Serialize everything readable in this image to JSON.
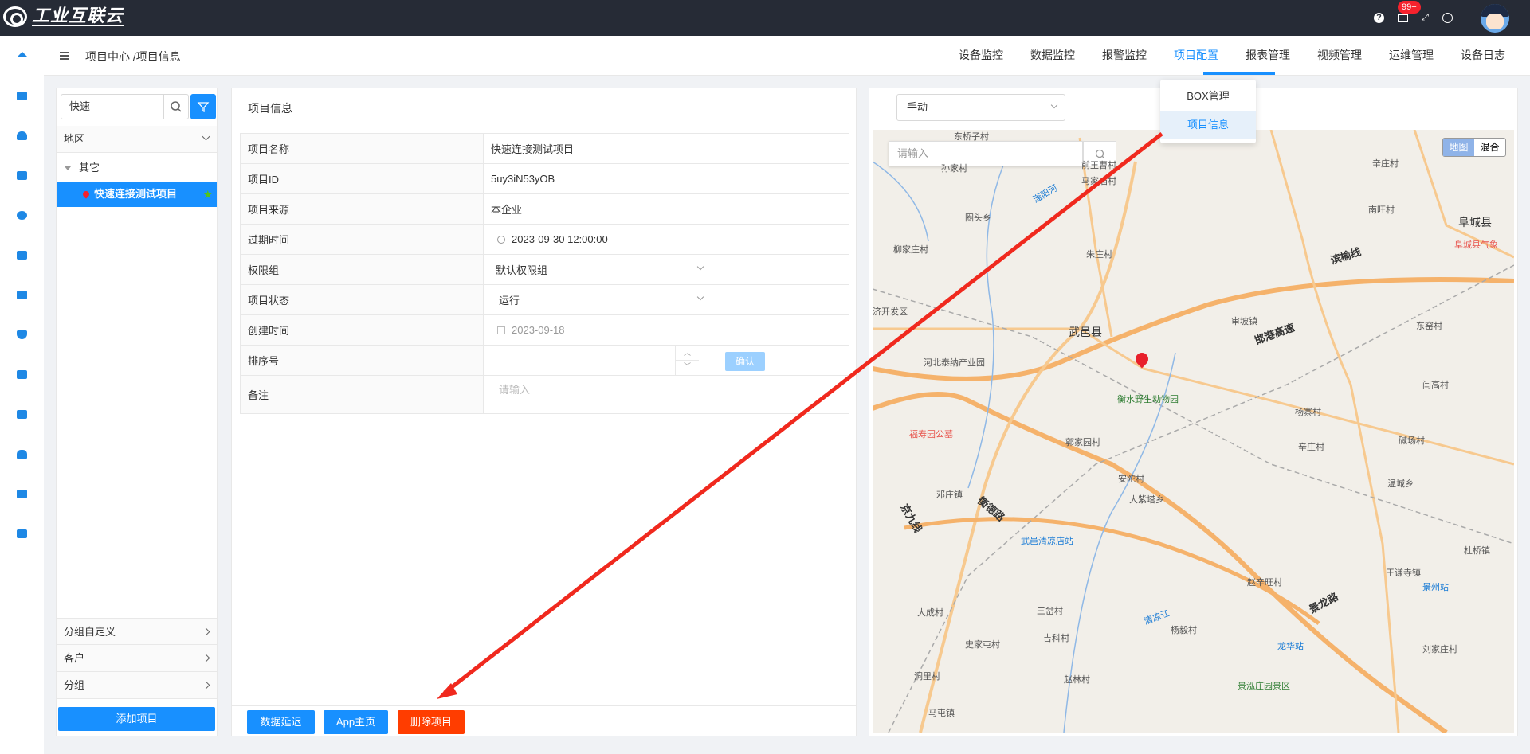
{
  "header": {
    "brand": "工业互联云",
    "badge": "99+",
    "icons": [
      "help-icon",
      "mail-icon",
      "fullscreen-icon",
      "globe-icon"
    ]
  },
  "sidebar": {
    "icons": [
      "home-icon",
      "project-icon",
      "alarm-icon",
      "database-icon",
      "settings-icon",
      "monitor-icon",
      "report-icon",
      "shield-icon",
      "list-icon",
      "device-icon",
      "users-icon",
      "box-icon",
      "dashboard-icon"
    ]
  },
  "nav": {
    "breadcrumb": "项目中心 /项目信息",
    "tabs": [
      "设备监控",
      "数据监控",
      "报警监控",
      "项目配置",
      "报表管理",
      "视频管理",
      "运维管理",
      "设备日志"
    ],
    "active_tab": "项目配置",
    "dropdown": [
      "BOX管理",
      "项目信息"
    ]
  },
  "left": {
    "search_value": "快速",
    "region_label": "地区",
    "group_label": "其它",
    "project_label": "快速连接测试项目",
    "sections": [
      "分组自定义",
      "客户",
      "分组"
    ],
    "add_button": "添加项目"
  },
  "info": {
    "title": "项目信息",
    "rows": [
      {
        "label": "项目名称",
        "value": "快速连接测试项目"
      },
      {
        "label": "项目ID",
        "value": "5uy3iN53yOB"
      },
      {
        "label": "项目来源",
        "value": "本企业"
      },
      {
        "label": "过期时间",
        "value": "2023-09-30 12:00:00"
      },
      {
        "label": "权限组",
        "value": "默认权限组"
      },
      {
        "label": "项目状态",
        "value": "运行"
      },
      {
        "label": "创建时间",
        "value": "2023-09-18"
      },
      {
        "label": "排序号",
        "value": ""
      },
      {
        "label": "备注",
        "value": ""
      }
    ],
    "confirm_label": "确认",
    "remark_placeholder": "请输入",
    "buttons": [
      "数据延迟",
      "App主页",
      "删除项目"
    ]
  },
  "map": {
    "mode": "手动",
    "search_placeholder": "请输入",
    "toggle_on": "地图",
    "toggle_off": "混合",
    "places": [
      "东桥子村",
      "前王曹村",
      "孙家村",
      "马家庙村",
      "圈头乡",
      "滏阳河",
      "辛庄村",
      "南旺村",
      "阜城县",
      "柳家庄村",
      "朱庄村",
      "滨榆线",
      "阜城县气象",
      "济开发区",
      "审坡镇",
      "武邑县",
      "邯港高速",
      "东窑村",
      "河北泰纳产业园",
      "衡水野生动物园",
      "杨寨村",
      "闫高村",
      "福寿园公墓",
      "郭家园村",
      "辛庄村",
      "碱场村",
      "邓庄镇",
      "安陀村",
      "大紫塔乡",
      "温城乡",
      "衡德路",
      "京九线",
      "武邑清凉店站",
      "杜桥镇",
      "王谦寺镇",
      "景州站",
      "赵辛旺村",
      "大成村",
      "三岔村",
      "清凉江",
      "景龙路",
      "史家屯村",
      "吉科村",
      "杨毅村",
      "龙华站",
      "刘家庄村",
      "洞里村",
      "赵林村",
      "景泓庄园景区",
      "马屯镇"
    ]
  }
}
